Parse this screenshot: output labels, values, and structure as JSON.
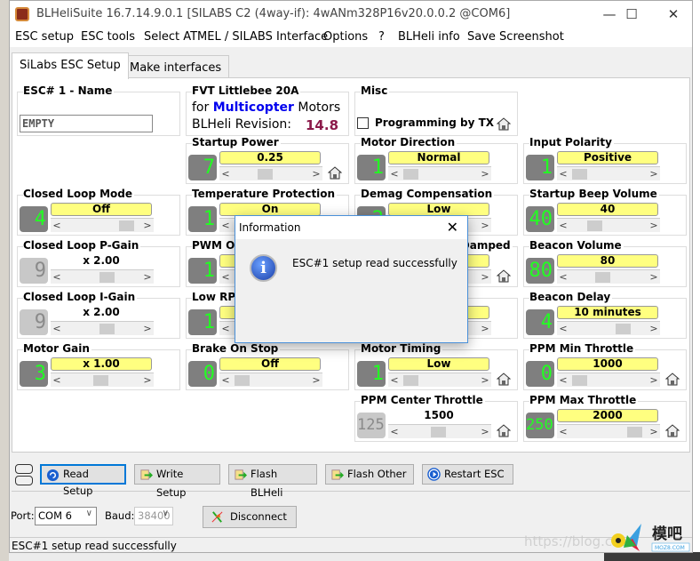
{
  "window": {
    "title": "BLHeliSuite 16.7.14.9.0.1  [SILABS C2 (4way-if): 4wANm328P16v20.0.0.2 @COM6]",
    "minimize": "—",
    "maximize": "☐",
    "close": "✕"
  },
  "menu": [
    "ESC setup",
    "ESC tools",
    "Select ATMEL / SILABS Interface",
    "Options",
    "?",
    "BLHeli info",
    "Save Screenshot"
  ],
  "tabs": [
    {
      "label": "SiLabs ESC Setup",
      "active": true
    },
    {
      "label": "Make interfaces",
      "active": false
    }
  ],
  "esc_name": {
    "label": "ESC# 1 - Name",
    "value": "EMPTY"
  },
  "esc_info": {
    "model": "FVT Littlebee 20A",
    "for": "for",
    "type": "Multicopter",
    "motors": "Motors",
    "revision_label": "BLHeli Revision:",
    "revision": "14.8"
  },
  "misc": {
    "label": "Misc",
    "checkbox_label": "Programming by TX",
    "checked": false
  },
  "cells": [
    {
      "label": "Startup Power",
      "digit": "7",
      "value": "0.25",
      "position": 0.42,
      "enabled": true,
      "house": true
    },
    {
      "label": "Motor Direction",
      "digit": "1",
      "value": "Normal",
      "position": 0.05,
      "enabled": true,
      "house": false
    },
    {
      "label": "Input Polarity",
      "digit": "1",
      "value": "Positive",
      "position": 0.05,
      "enabled": true,
      "house": false
    },
    {
      "label": "Closed Loop Mode",
      "digit": "4",
      "value": "Off",
      "position": 0.92,
      "enabled": true,
      "house": false
    },
    {
      "label": "Temperature Protection",
      "digit": "1",
      "value": "On",
      "position": 0.05,
      "enabled": true,
      "house": false
    },
    {
      "label": "Demag Compensation",
      "digit": "2",
      "value": "Low",
      "position": 0.05,
      "enabled": true,
      "house": false
    },
    {
      "label": "Startup Beep Volume",
      "digit": "40",
      "value": "40",
      "position": 0.3,
      "enabled": true,
      "house": false
    },
    {
      "label": "Closed Loop P-Gain",
      "digit": "9",
      "value": "x 2.00",
      "position": 0.6,
      "enabled": false,
      "house": false
    },
    {
      "label": "PWM Output",
      "digit": "1",
      "value": "",
      "position": 0.05,
      "enabled": true,
      "house": false
    },
    {
      "label": "PWM Frequency/Damped",
      "digit": "",
      "value": "",
      "position": 0.05,
      "enabled": true,
      "house": true
    },
    {
      "label": "Beacon Volume",
      "digit": "80",
      "value": "80",
      "position": 0.42,
      "enabled": true,
      "house": false
    },
    {
      "label": "Closed Loop I-Gain",
      "digit": "9",
      "value": "x 2.00",
      "position": 0.6,
      "enabled": false,
      "house": false
    },
    {
      "label": "Low RPM Power Protect",
      "digit": "1",
      "value": "",
      "position": 0.05,
      "enabled": true,
      "house": false
    },
    {
      "label": "",
      "digit": "",
      "value": "",
      "position": 0.05,
      "enabled": true,
      "house": false
    },
    {
      "label": "Beacon Delay",
      "digit": "4",
      "value": "10 minutes",
      "position": 0.76,
      "enabled": true,
      "house": false
    },
    {
      "label": "Motor Gain",
      "digit": "3",
      "value": "x 1.00",
      "position": 0.5,
      "enabled": true,
      "house": false
    },
    {
      "label": "Brake On Stop",
      "digit": "0",
      "value": "Off",
      "position": 0.05,
      "enabled": true,
      "house": false
    },
    {
      "label": "Motor Timing",
      "digit": "1",
      "value": "Low",
      "position": 0.05,
      "enabled": true,
      "house": true
    },
    {
      "label": "PPM Min Throttle",
      "digit": "0",
      "value": "1000",
      "position": 0.05,
      "enabled": true,
      "house": true
    },
    {
      "label": "PPM Center Throttle",
      "digit": "125",
      "value": "1500",
      "position": 0.5,
      "enabled": false,
      "house": true
    },
    {
      "label": "PPM Max Throttle",
      "digit": "250",
      "value": "2000",
      "position": 0.95,
      "enabled": true,
      "house": true
    }
  ],
  "dialog": {
    "title": "Information",
    "message": "ESC#1 setup read successfully",
    "icon": "info-icon",
    "close": "✕"
  },
  "buttons": [
    {
      "label": "Read Setup",
      "icon": "read-icon",
      "focused": true
    },
    {
      "label": "Write Setup",
      "icon": "write-icon",
      "focused": false
    },
    {
      "label": "Flash BLHeli",
      "icon": "flash-icon",
      "focused": false
    },
    {
      "label": "Flash Other",
      "icon": "flash-icon",
      "focused": false
    },
    {
      "label": "Restart ESC",
      "icon": "restart-icon",
      "focused": false
    }
  ],
  "port": {
    "port_label": "Port:",
    "port_value": "COM 6",
    "baud_label": "Baud:",
    "baud_value": "38400",
    "disconnect": "Disconnect"
  },
  "status": "ESC#1 setup read successfully",
  "watermark": "https://blog.cs",
  "logo_text": "模吧 MOZ8.COM",
  "colors": {
    "value_bg": "#ffff80",
    "digit_fg": "#22ff22",
    "digit_bg": "#7f7f7f",
    "multicopter": "#0000ee",
    "revision": "#8b1a4a"
  }
}
